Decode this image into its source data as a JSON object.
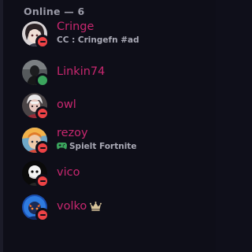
{
  "section": {
    "header": "Online — 6"
  },
  "members": [
    {
      "name": "Cringe",
      "activity": "CC : Cringefn #ad",
      "status": "dnd"
    },
    {
      "name": "Linkin74",
      "status": "online"
    },
    {
      "name": "owl",
      "status": "dnd"
    },
    {
      "name": "rezoy",
      "activity": "Spielt Fortnite",
      "activity_icon": "gamepad-icon",
      "status": "dnd"
    },
    {
      "name": "vico",
      "status": "dnd"
    },
    {
      "name": "volko",
      "badge_icon": "crown-icon",
      "status": "dnd"
    }
  ],
  "colors": {
    "background": "#0e0e18",
    "name_color": "#c8276f",
    "header_color": "#9b9ba8",
    "dnd": "#ed4245",
    "online": "#3ba55d"
  }
}
